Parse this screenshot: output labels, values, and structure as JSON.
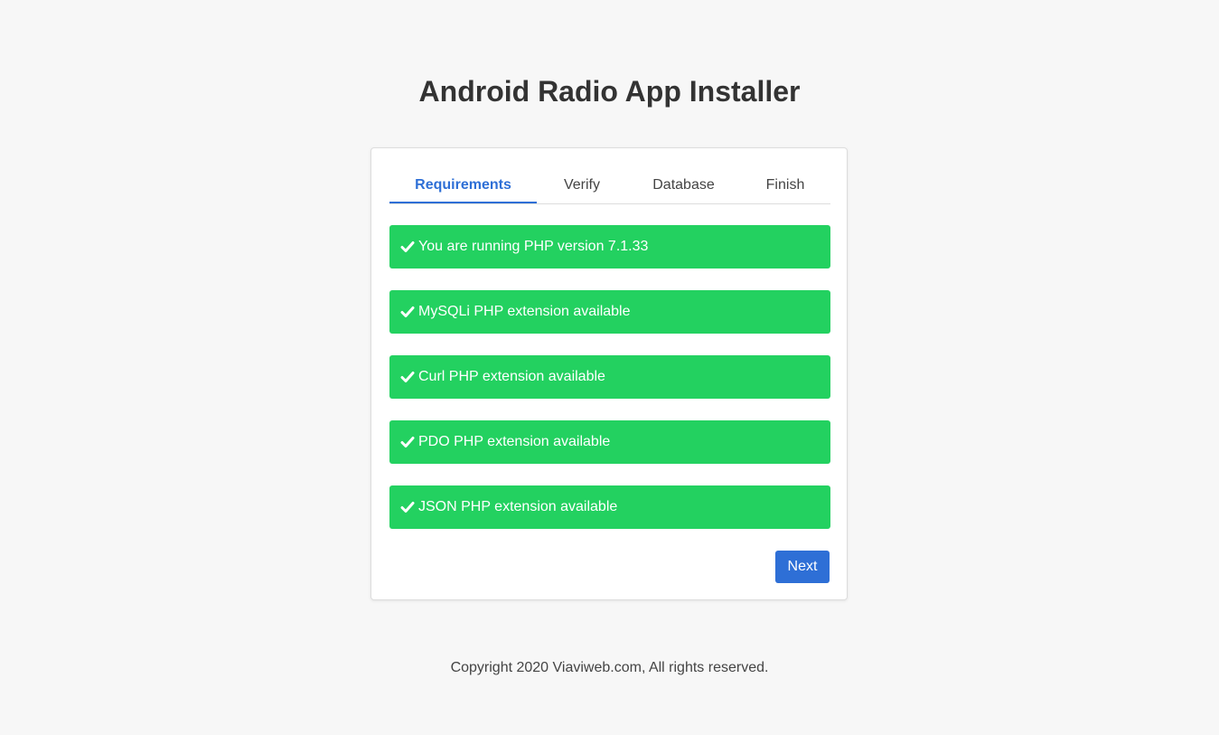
{
  "page": {
    "title": "Android Radio App Installer",
    "footer": "Copyright 2020 Viaviweb.com, All rights reserved."
  },
  "tabs": [
    {
      "label": "Requirements",
      "active": true
    },
    {
      "label": "Verify",
      "active": false
    },
    {
      "label": "Database",
      "active": false
    },
    {
      "label": "Finish",
      "active": false
    }
  ],
  "requirements": [
    {
      "icon": "check-icon",
      "text": "You are running PHP version 7.1.33"
    },
    {
      "icon": "check-icon",
      "text": "MySQLi PHP extension available"
    },
    {
      "icon": "check-icon",
      "text": "Curl PHP extension available"
    },
    {
      "icon": "check-icon",
      "text": "PDO PHP extension available"
    },
    {
      "icon": "check-icon",
      "text": "JSON PHP extension available"
    }
  ],
  "actions": {
    "next_label": "Next"
  },
  "colors": {
    "background": "#f7f7f7",
    "accent": "#2e6fd6",
    "success": "#23d160"
  }
}
